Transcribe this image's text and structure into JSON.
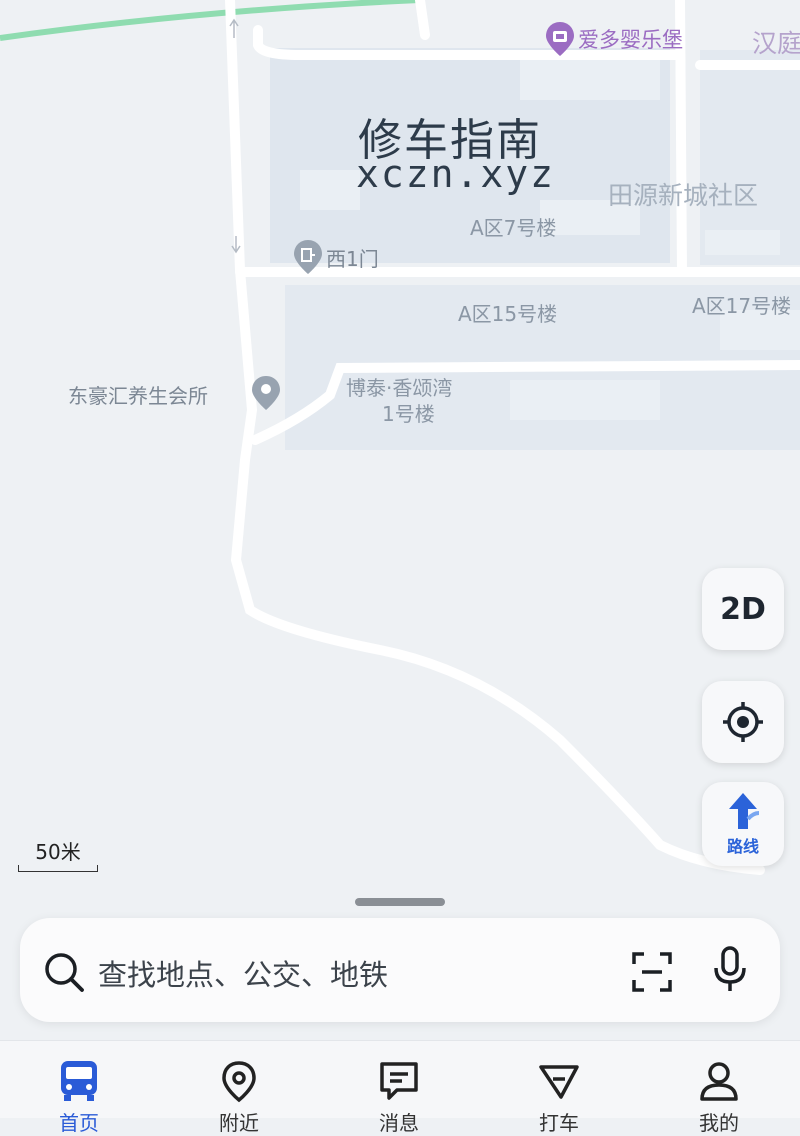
{
  "map": {
    "pois": {
      "toy_store": "爱多婴乐堡",
      "hanting": "汉庭",
      "west_gate": "西1门",
      "spa": "东豪汇养生会所"
    },
    "labels": {
      "community": "田源新城社区",
      "building_a7": "A区7号楼",
      "building_a15": "A区15号楼",
      "building_a17": "A区17号楼",
      "botai_line1": "博泰·香颂湾",
      "botai_line2": "1号楼"
    },
    "watermark": {
      "title": "修车指南",
      "subtitle": "xczn.xyz"
    }
  },
  "controls": {
    "mode_label": "2D",
    "route_label": "路线"
  },
  "scale": {
    "label": "50米"
  },
  "search": {
    "placeholder": "查找地点、公交、地铁"
  },
  "tabbar": {
    "home": "首页",
    "nearby": "附近",
    "messages": "消息",
    "taxi": "打车",
    "mine": "我的"
  },
  "colors": {
    "accent": "#2a5bd7",
    "map_bg": "#eef1f4",
    "road": "#ffffff",
    "highway": "#7fd6a6",
    "poi_purple": "#9b6cc2"
  }
}
